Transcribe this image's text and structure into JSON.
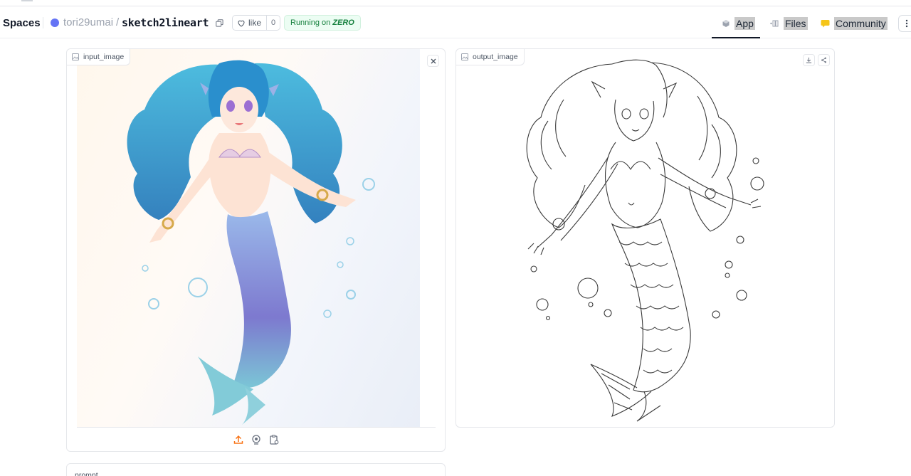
{
  "header": {
    "brand": "Spaces",
    "owner": "tori29umai",
    "separator": "/",
    "repo": "sketch2lineart",
    "like_label": "like",
    "like_count": "0",
    "running_prefix": "Running on",
    "running_hardware": "ZERO",
    "tabs": [
      {
        "label": "App"
      },
      {
        "label": "Files"
      },
      {
        "label": "Community"
      }
    ],
    "colors": {
      "owner_avatar": "#6574f5",
      "running_bg": "#ecfdf3",
      "running_text": "#15803d",
      "community_icon": "#f5c518"
    }
  },
  "input": {
    "label": "input_image",
    "icons": [
      "upload-icon",
      "webcam-icon",
      "clipboard-icon"
    ]
  },
  "output": {
    "label": "output_image"
  },
  "prompt": {
    "label": "prompt"
  }
}
